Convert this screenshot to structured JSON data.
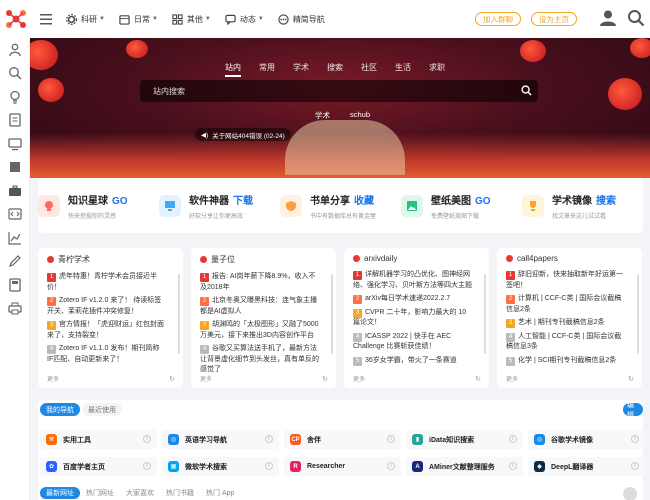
{
  "header": {
    "nav": [
      {
        "label": "科研",
        "icon": "gear-icon"
      },
      {
        "label": "日常",
        "icon": "calendar-icon"
      },
      {
        "label": "其他",
        "icon": "grid-icon"
      },
      {
        "label": "动态",
        "icon": "chat-icon"
      },
      {
        "label": "精简导航",
        "icon": "dots-icon"
      }
    ],
    "join_label": "加入群聊",
    "home_label": "设为主页",
    "accent": "#f5a623"
  },
  "banner": {
    "tabs": [
      "站内",
      "常用",
      "学术",
      "搜索",
      "社区",
      "生活",
      "求职"
    ],
    "search_placeholder": "站内搜索",
    "subtags": [
      "学术",
      "schub"
    ],
    "notice": "关于网站404错误 (02-24)"
  },
  "features": [
    {
      "title": "知识星球",
      "action": "GO",
      "desc": "快来挖掘你的灵感",
      "color": "#ff6b5a",
      "icon": "lightbulb-icon"
    },
    {
      "title": "软件神器",
      "action": "下载",
      "desc": "好软分享让你更高效",
      "color": "#3fa9f5",
      "icon": "monitor-icon"
    },
    {
      "title": "书单分享",
      "action": "收藏",
      "desc": "书中有数据库总有黄金屋",
      "color": "#ff9f43",
      "icon": "shield-icon"
    },
    {
      "title": "壁纸美图",
      "action": "GO",
      "desc": "免费壁纸美图下载",
      "color": "#26c281",
      "icon": "image-icon"
    },
    {
      "title": "学术镜像",
      "action": "搜索",
      "desc": "找文章来这儿试试看",
      "color": "#f5a623",
      "icon": "trophy-icon"
    }
  ],
  "cards": [
    {
      "title": "青柠学术",
      "items": [
        "虎年特惠！青柠学术会员接近半价！",
        "Zotero IF v1.2.0 来了！ 待读标签开关、茉莉花插件冲突修复！",
        "官方情报！「虎迎财运」红包封面来了，支持裂变！",
        "Zotero IF v1.1.0 发布！期刊简称 IF匹配、自动更新来了！"
      ],
      "more": "更多"
    },
    {
      "title": "量子位",
      "items": [
        "报告: AI岗年薪下降8.9%，收入不及2018年",
        "北京冬奥又曝黑科技：连气象主播都是AI虚拟人",
        "胡渊鸣的「太极图形」又融了5000万美元，接下来推出3D内容创作平台",
        "谷歌又买算法送手机了，最新方法让背景虚化细节到头发丝，真有单反的感觉了"
      ],
      "more": "更多"
    },
    {
      "title": "arxivdaily",
      "items": [
        "详解机器学习的凸优化、图神经网络、强化学习、贝叶斯方法等四大主题",
        "arXiv每日学术速递2022.2.7",
        "CVPR 二十年，影响力最大的 10 篇论文！",
        "ICASSP 2022 | 快手在 AEC Challenge 比赛斩获佳绩！",
        "36岁女学霸，带火了一条赛道"
      ],
      "more": "更多"
    },
    {
      "title": "call4papers",
      "items": [
        "辞旧迎新，快来抽取新年好运第一签吧！",
        "计算机 | CCF-C类 | 国际会议截稿信息2条",
        "艺术 | 期刊专刊截稿信息2条",
        "人工智能 | CCF-C类 | 国际会议截稿信息3条",
        "化学 | SCI期刊专刊截稿信息2条"
      ],
      "more": "更多"
    }
  ],
  "my_nav": {
    "tabs": [
      "我的导航",
      "最近使用"
    ],
    "edit_label": "编辑",
    "links": [
      {
        "label": "实用工具",
        "color": "#ff6b00",
        "glyph": "⚒"
      },
      {
        "label": "英语学习导航",
        "color": "#1e88e5",
        "glyph": "◎"
      },
      {
        "label": "舍伴",
        "color": "#ff5722",
        "glyph": "CP"
      },
      {
        "label": "iData知识搜索",
        "color": "#26a69a",
        "glyph": "▮"
      },
      {
        "label": "谷歌学术镜像",
        "color": "#1e88e5",
        "glyph": "◎"
      },
      {
        "label": "百度学者主页",
        "color": "#2962ff",
        "glyph": "✿"
      },
      {
        "label": "微软学术搜索",
        "color": "#00a4ef",
        "glyph": "▦"
      },
      {
        "label": "Researcher",
        "color": "#e91e63",
        "glyph": "R"
      },
      {
        "label": "AMiner文献整理服务",
        "color": "#1a237e",
        "glyph": "A"
      },
      {
        "label": "DeepL翻译器",
        "color": "#0f2b46",
        "glyph": "◆"
      }
    ]
  },
  "bottom_tabs": [
    "最新网址",
    "热门网址",
    "大家喜欢",
    "热门书籍",
    "热门 App"
  ]
}
